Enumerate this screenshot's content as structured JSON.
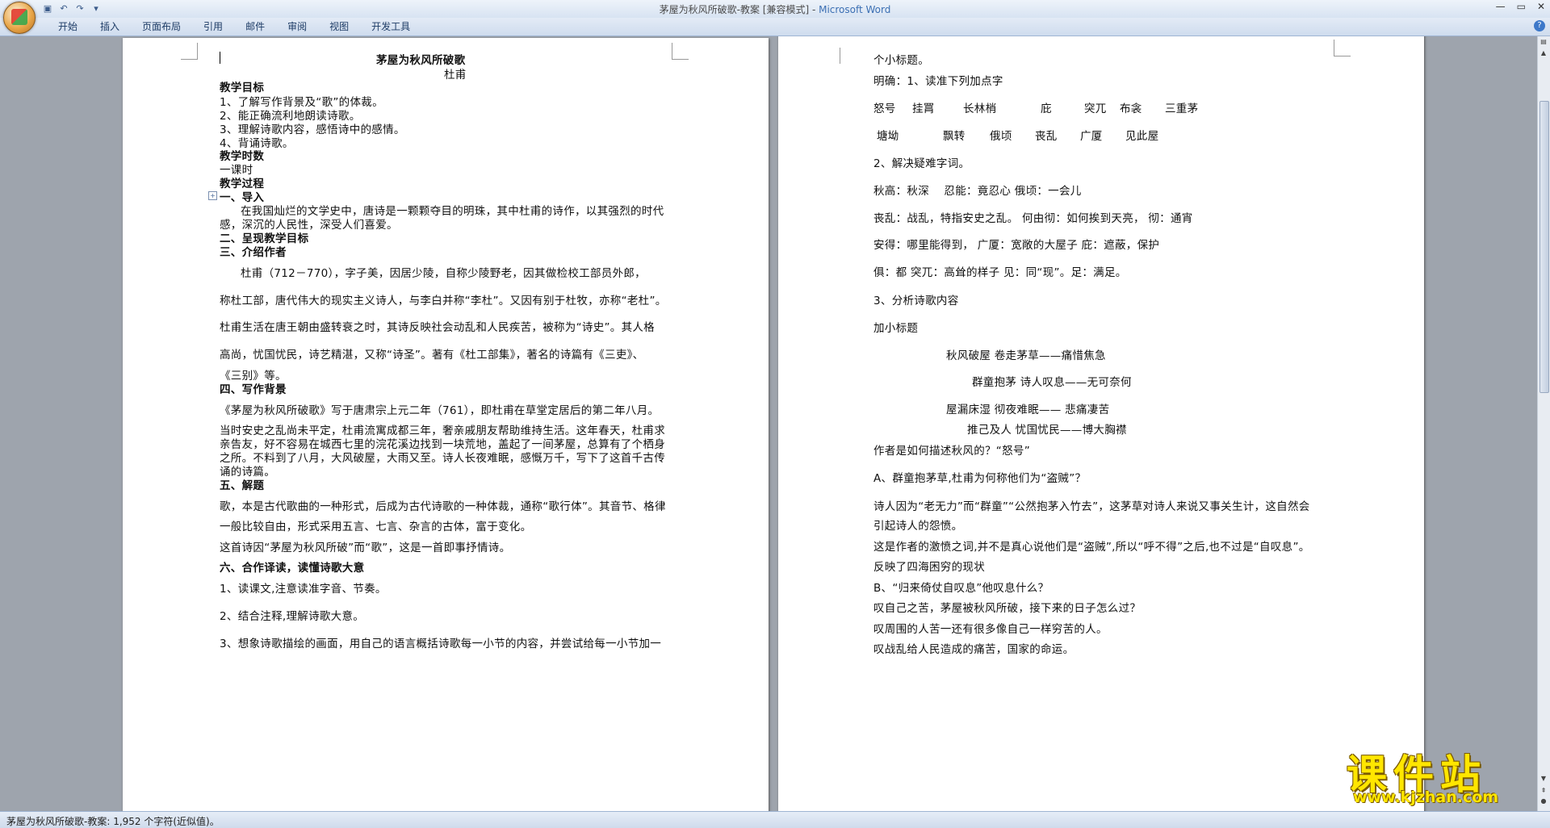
{
  "window": {
    "title": "茅屋为秋风所破歌-教案 [兼容模式] - ",
    "app_name": "Microsoft Word"
  },
  "ribbon": {
    "tabs": [
      "开始",
      "插入",
      "页面布局",
      "引用",
      "邮件",
      "审阅",
      "视图",
      "开发工具"
    ]
  },
  "page1": {
    "title": "茅屋为秋风所破歌",
    "author": "杜甫",
    "h_goal": "教学目标",
    "goal1": "1、了解写作背景及“歌”的体裁。",
    "goal2": "2、能正确流利地朗读诗歌。",
    "goal3": "3、理解诗歌内容，感悟诗中的感情。",
    "goal4": "4、背诵诗歌。",
    "h_time": "教学时数",
    "time": "一课时",
    "h_process": "教学过程",
    "s1": "一、导入",
    "intro1": "在我国灿烂的文学史中，唐诗是一颗颗夺目的明珠，其中杜甫的诗作，以其强烈的时代",
    "intro2": "感，深沉的人民性，深受人们喜爱。",
    "s2": "二、呈现教学目标",
    "s3": "三、介绍作者",
    "author1": "杜甫（712－770），字子美，因居少陵，自称少陵野老，因其做检校工部员外郎，",
    "author2": "称杜工部，唐代伟大的现实主义诗人，与李白并称“李杜”。又因有别于杜牧，亦称“老杜”。",
    "author3": "杜甫生活在唐王朝由盛转衰之时，其诗反映社会动乱和人民疾苦，被称为“诗史”。其人格",
    "author4": "高尚，忧国忧民，诗艺精湛，又称“诗圣”。著有《杜工部集》，著名的诗篇有《三吏》、",
    "author5": "《三别》等。",
    "s4": "四、写作背景",
    "bg1": "《茅屋为秋风所破歌》写于唐肃宗上元二年（761），即杜甫在草堂定居后的第二年八月。",
    "bg2": "当时安史之乱尚未平定，杜甫流寓成都三年，奢亲戚朋友帮助维持生活。这年春天，杜甫求",
    "bg3": "亲告友，好不容易在城西七里的浣花溪边找到一块荒地，盖起了一间茅屋，总算有了个栖身",
    "bg4": "之所。不料到了八月，大风破屋，大雨又至。诗人长夜难眠，感慨万千，写下了这首千古传",
    "bg5": "诵的诗篇。",
    "s5": "五、解题",
    "jt1": "歌，本是古代歌曲的一种形式，后成为古代诗歌的一种体裁，通称“歌行体”。其音节、格律",
    "jt2": "一般比较自由，形式采用五言、七言、杂言的古体，富于变化。",
    "jt3": "这首诗因“茅屋为秋风所破”而“歌”，这是一首即事抒情诗。",
    "s6": "六、合作译读，读懂诗歌大意",
    "c1": "1、读课文,注意读准字音、节奏。",
    "c2": "2、结合注释,理解诗歌大意。",
    "c3": "3、想象诗歌描绘的画面，用自己的语言概括诗歌每一小节的内容，并尝试给每一小节加一"
  },
  "page2": {
    "l1": "个小标题。",
    "l2": "明确：1、读准下列加点字",
    "w1": [
      "怒号",
      "挂罥",
      "长林梢",
      "庇",
      "突兀",
      "布衾",
      "三重茅"
    ],
    "w2": [
      "塘坳",
      "飘转",
      "俄顷",
      "丧乱",
      "广厦",
      "见此屋"
    ],
    "l3": "2、解决疑难字词。",
    "d1": "秋高：秋深　 忍能：竟忍心 俄顷：一会儿",
    "d2": "丧乱：战乱，特指安史之乱。 何由彻：如何挨到天亮， 彻：通宵",
    "d3": "安得：哪里能得到， 广厦：宽敞的大屋子 庇：遮蔽，保护",
    "d4": "俱：都 突兀：高耸的样子 见：同“现”。足：满足。",
    "l4": "3、分析诗歌内容",
    "l5": "加小标题",
    "t1": "秋风破屋 卷走茅草——痛惜焦急",
    "t2": "群童抱茅 诗人叹息——无可奈何",
    "t3": "屋漏床湿 彻夜难眠—— 悲痛凄苦",
    "t4": "推己及人 忧国忧民——博大胸襟",
    "q1": "作者是如何描述秋风的？“怒号”",
    "qa": "A、群童抱茅草,杜甫为何称他们为“盗贼”？",
    "a1": "诗人因为“老无力”而“群童”“公然抱茅入竹去”，这茅草对诗人来说又事关生计，这自然会",
    "a2": "引起诗人的怨愤。",
    "a3": "这是作者的激愤之词,并不是真心说他们是“盗贼”,所以“呼不得”之后,也不过是“自叹息”。",
    "a4": "反映了四海困穷的现状",
    "qb": "B、“归来倚仗自叹息”他叹息什么？",
    "b1": "叹自己之苦，茅屋被秋风所破，接下来的日子怎么过？",
    "b2": "叹周围的人苦一还有很多像自己一样穷苦的人。",
    "b3": "叹战乱给人民造成的痛苦，国家的命运。"
  },
  "status": {
    "text": "茅屋为秋风所破歌-教案: 1,952 个字符(近似值)。"
  },
  "watermark": {
    "main": "课件站",
    "url": "www.kjzhan.com"
  }
}
